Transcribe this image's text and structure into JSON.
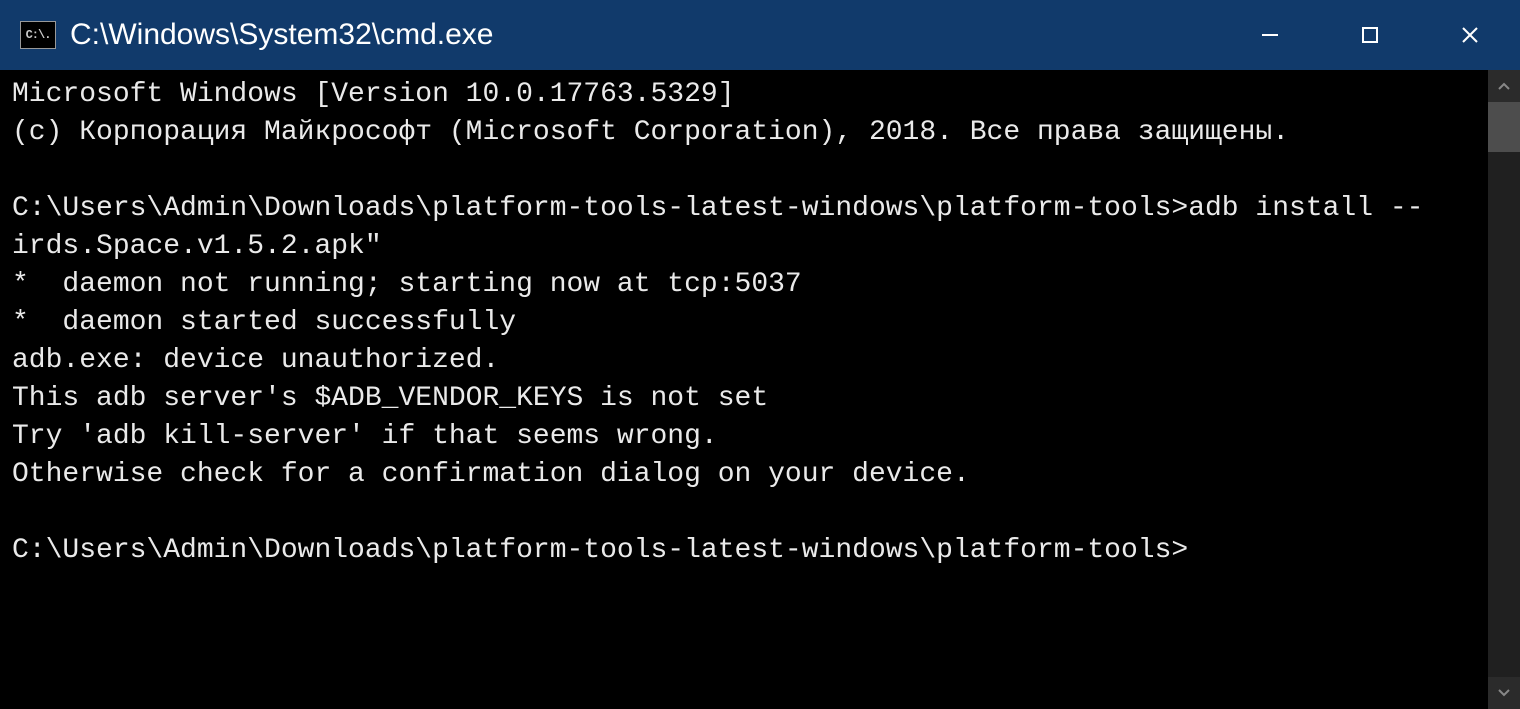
{
  "titlebar": {
    "icon_label": "C:\\.",
    "title": "C:\\Windows\\System32\\cmd.exe"
  },
  "terminal": {
    "lines": [
      "Microsoft Windows [Version 10.0.17763.5329]",
      "(c) Корпорация Майкрософт (Microsoft Corporation), 2018. Все права защищены.",
      "",
      "C:\\Users\\Admin\\Downloads\\platform-tools-latest-windows\\platform-tools>adb install --",
      "irds.Space.v1.5.2.apk\"",
      "*  daemon not running; starting now at tcp:5037",
      "*  daemon started successfully",
      "adb.exe: device unauthorized.",
      "This adb server's $ADB_VENDOR_KEYS is not set",
      "Try 'adb kill-server' if that seems wrong.",
      "Otherwise check for a confirmation dialog on your device.",
      "",
      "C:\\Users\\Admin\\Downloads\\platform-tools-latest-windows\\platform-tools>"
    ]
  }
}
